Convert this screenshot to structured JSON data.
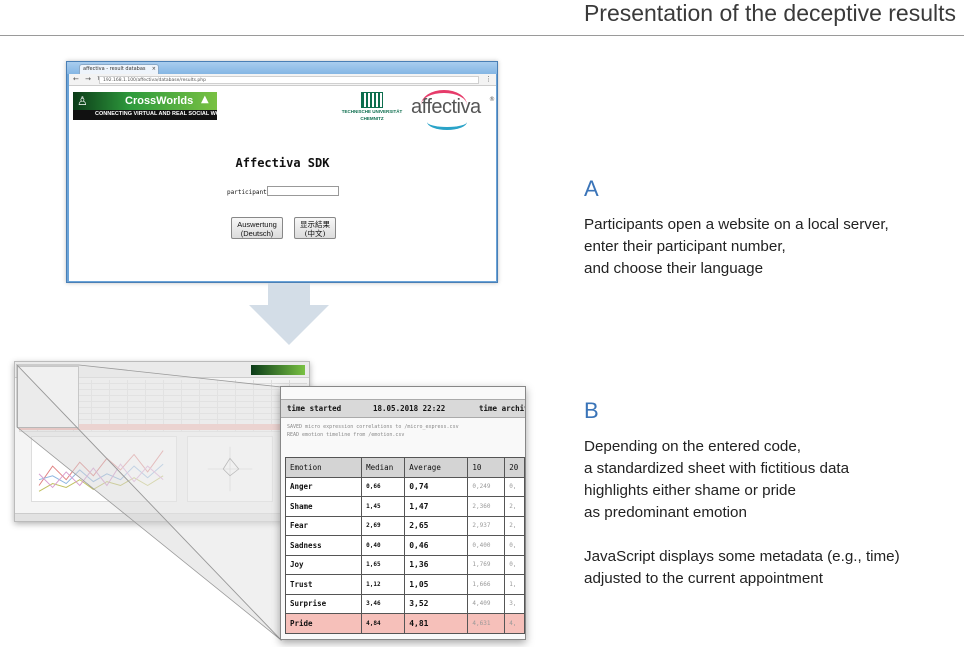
{
  "header": {
    "title": "Presentation of the deceptive results"
  },
  "browser": {
    "tab_title": "affectiva - result databas",
    "url": "192.168.1.100/affectiva/database/results.php",
    "nav_icons": "← → ↻",
    "menu_icon": "⋮",
    "logos": {
      "crossworlds_name": "CrossWorlds",
      "crossworlds_tagline": "CONNECTING VIRTUAL AND REAL SOCIAL WORLDS",
      "tu_line1": "TECHNISCHE UNIVERSITÄT",
      "tu_line2": "CHEMNITZ",
      "affectiva": "affectiva",
      "affectiva_reg": "®"
    },
    "sdk_title": "Affectiva SDK",
    "participant_label": "participant:",
    "participant_value": "",
    "button_de_line1": "Auswertung",
    "button_de_line2": "(Deutsch)",
    "button_zh_line1": "显示結果",
    "button_zh_line2": "(中文)"
  },
  "zoom": {
    "time_started_label": "time started",
    "time_started_value": "18.05.2018 22:22",
    "time_archive_label": "time archiv",
    "log_line1": "SAVED micro expression correlations to /micro_express.csv",
    "log_line2": "READ emotion timeline from /emotion.csv",
    "columns": [
      "Emotion",
      "Median",
      "Average",
      "10",
      "20"
    ],
    "rows": [
      {
        "emotion": "Anger",
        "median": "0,66",
        "average": "0,74",
        "c10": "0,249",
        "c20": "0,"
      },
      {
        "emotion": "Shame",
        "median": "1,45",
        "average": "1,47",
        "c10": "2,360",
        "c20": "2,"
      },
      {
        "emotion": "Fear",
        "median": "2,69",
        "average": "2,65",
        "c10": "2,937",
        "c20": "2,"
      },
      {
        "emotion": "Sadness",
        "median": "0,40",
        "average": "0,46",
        "c10": "0,400",
        "c20": "0,"
      },
      {
        "emotion": "Joy",
        "median": "1,65",
        "average": "1,36",
        "c10": "1,769",
        "c20": "0,"
      },
      {
        "emotion": "Trust",
        "median": "1,12",
        "average": "1,05",
        "c10": "1,666",
        "c20": "1,"
      },
      {
        "emotion": "Surprise",
        "median": "3,46",
        "average": "3,52",
        "c10": "4,409",
        "c20": "3,"
      },
      {
        "emotion": "Pride",
        "median": "4,84",
        "average": "4,81",
        "c10": "4,631",
        "c20": "4,"
      }
    ],
    "highlight_color": "#f6c0ba"
  },
  "sections": {
    "a_label": "A",
    "a_text": [
      "Participants open a website on a local server,",
      "enter their participant number,",
      "and choose their language"
    ],
    "b_label": "B",
    "b_text1": [
      "Depending on the entered code,",
      "a standardized sheet with fictitious data",
      "highlights either shame or pride",
      "as predominant emotion"
    ],
    "b_text2": [
      "JavaScript displays some metadata (e.g., time)",
      "adjusted to the current appointment"
    ],
    "accent_color": "#3a74b8"
  }
}
